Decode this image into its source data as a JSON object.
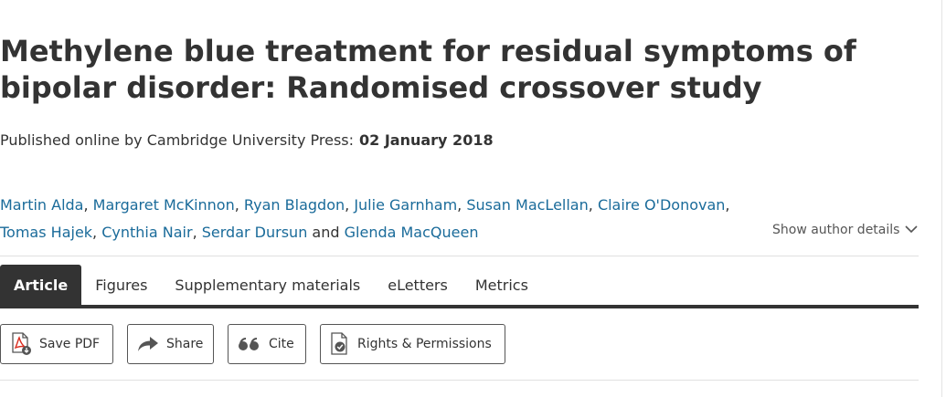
{
  "article": {
    "title": "Methylene blue treatment for residual symptoms of bipolar disorder: Randomised crossover study",
    "published_label": "Published online by Cambridge University Press:",
    "published_date": "02 January 2018"
  },
  "authors": [
    "Martin Alda",
    "Margaret McKinnon",
    "Ryan Blagdon",
    "Julie Garnham",
    "Susan MacLellan",
    "Claire O'Donovan",
    "Tomas Hajek",
    "Cynthia Nair",
    "Serdar Dursun",
    "Glenda MacQueen"
  ],
  "authors_separators": {
    "comma": ",",
    "and": "and"
  },
  "show_author_details": {
    "label": "Show author details",
    "icon": "chevron-down-icon"
  },
  "tabs": [
    {
      "label": "Article",
      "active": true
    },
    {
      "label": "Figures",
      "active": false
    },
    {
      "label": "Supplementary materials",
      "active": false
    },
    {
      "label": "eLetters",
      "active": false
    },
    {
      "label": "Metrics",
      "active": false
    }
  ],
  "actions": {
    "save_pdf": {
      "label": "Save PDF",
      "icon": "pdf-icon"
    },
    "share": {
      "label": "Share",
      "icon": "share-arrow-icon"
    },
    "cite": {
      "label": "Cite",
      "icon": "quote-icon"
    },
    "rights": {
      "label": "Rights & Permissions",
      "icon": "rights-document-icon"
    }
  },
  "colors": {
    "link": "#1a6b9a",
    "text": "#333333",
    "tab_active_bg": "#333333",
    "pdf_red": "#d92d20"
  }
}
